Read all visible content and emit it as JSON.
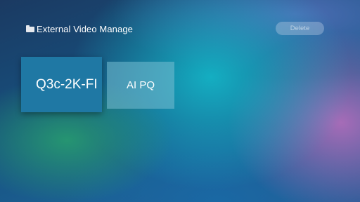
{
  "header": {
    "folder_icon": "folder-icon",
    "title": "External Video Manage",
    "delete_label": "Delete"
  },
  "items": [
    {
      "label": "Q3c-2K-FI",
      "selected": true
    },
    {
      "label": "AI PQ",
      "selected": false
    }
  ],
  "colors": {
    "selected_card": "#1f78a4",
    "text": "#ffffff"
  }
}
